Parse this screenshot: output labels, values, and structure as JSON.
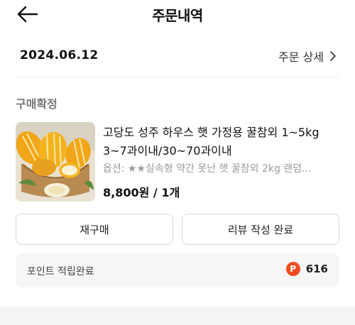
{
  "header": {
    "title": "주문내역",
    "back_icon": "arrow-left-icon"
  },
  "order": {
    "date": "2024.06.12",
    "detail_link": "주문 상세",
    "status": "구매확정",
    "product": {
      "name": "고당도 성주 하우스 햇 가정용 꿀참외 1~5kg 3~7과이내/30~70과이내",
      "option": "옵션: ★★실속형 약간 못난 햇 꿀참외 2kg 랜덤...",
      "price": "8,800원 / 1개",
      "image": "korean-melon-photo"
    },
    "buttons": {
      "rebuy": "재구매",
      "review": "리뷰 작성 완료"
    },
    "points": {
      "label": "포인트 적립완료",
      "badge": "P",
      "value": "616",
      "badge_color": "#f04b23"
    }
  }
}
